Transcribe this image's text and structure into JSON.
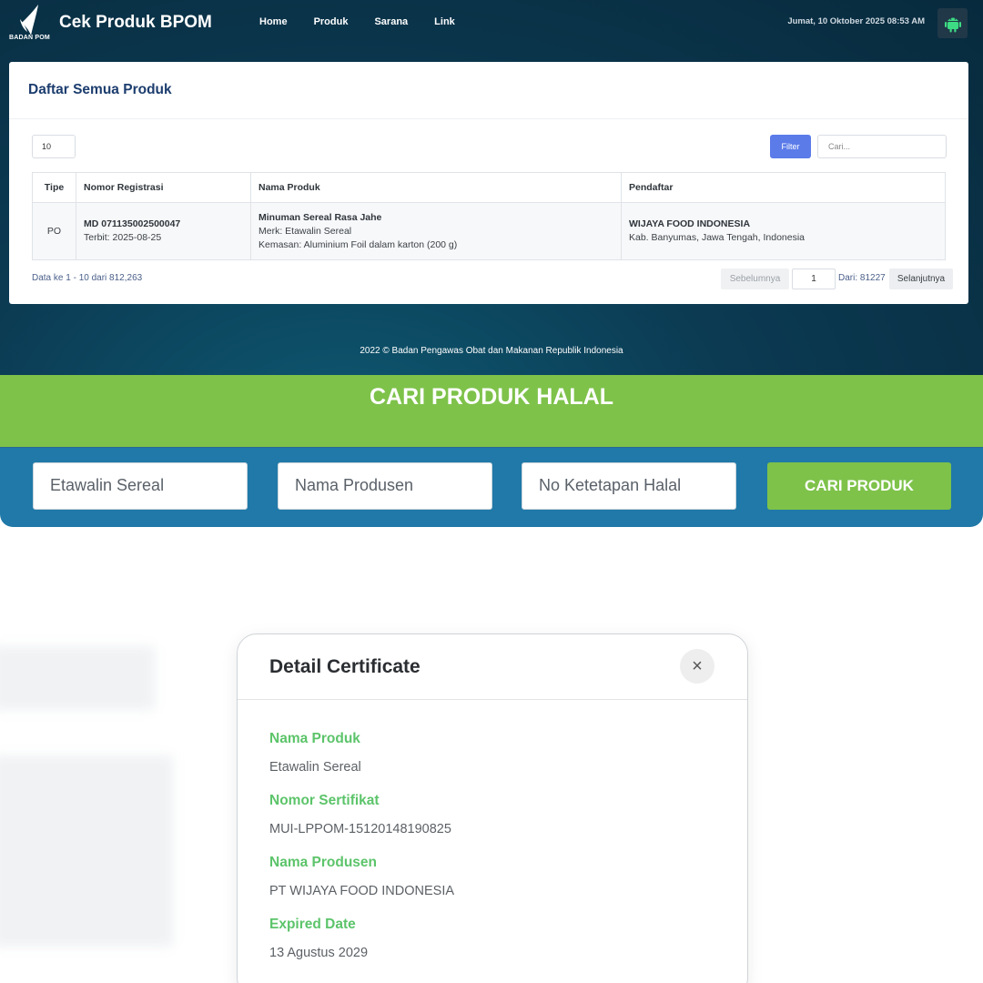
{
  "bpom": {
    "logo_text": "BADAN POM",
    "brand": "Cek Produk BPOM",
    "menu": [
      "Home",
      "Produk",
      "Sarana",
      "Link"
    ],
    "datetime": "Jumat, 10 Oktober 2025 08:53 AM",
    "card_title": "Daftar Semua Produk",
    "per_page": "10",
    "filter_label": "Filter",
    "search_placeholder": "Cari...",
    "table": {
      "headers": [
        "Tipe",
        "Nomor Registrasi",
        "Nama Produk",
        "Pendaftar"
      ],
      "row": {
        "tipe": "PO",
        "nomor": "MD 071135002500047",
        "terbit": "Terbit: 2025-08-25",
        "nama": "Minuman Sereal Rasa Jahe",
        "merk": "Merk: Etawalin Sereal",
        "kemasan": "Kemasan: Aluminium Foil dalam karton (200 g)",
        "pendaftar": "WIJAYA FOOD INDONESIA",
        "lokasi": "Kab. Banyumas, Jawa Tengah, Indonesia"
      }
    },
    "paging_info": "Data ke 1 - 10 dari 812,263",
    "prev_label": "Sebelumnya",
    "page_value": "1",
    "page_of": "Dari: 81227",
    "next_label": "Selanjutnya",
    "footer": "2022 ©  Badan Pengawas Obat dan Makanan Republik Indonesia"
  },
  "halal": {
    "title": "CARI PRODUK HALAL",
    "product_value": "Etawalin Sereal",
    "producer_placeholder": "Nama Produsen",
    "number_placeholder": "No Ketetapan Halal",
    "search_button": "CARI PRODUK"
  },
  "modal": {
    "title": "Detail Certificate",
    "close": "×",
    "fields": [
      {
        "label": "Nama Produk",
        "value": "Etawalin Sereal"
      },
      {
        "label": "Nomor Sertifikat",
        "value": "MUI-LPPOM-15120148190825"
      },
      {
        "label": "Nama Produsen",
        "value": "PT WIJAYA FOOD INDONESIA"
      },
      {
        "label": "Expired Date",
        "value": "13 Agustus 2029"
      }
    ]
  },
  "colors": {
    "bpom_bg": "#0b3a52",
    "filter_button": "#5b7be9",
    "halal_green": "#7ec24a",
    "halal_blue": "#2079a8",
    "modal_label_green": "#5cc46a",
    "android_green": "#3ddc84"
  },
  "icons": {
    "logo": "bpom-logo-icon",
    "android": "android-icon",
    "close": "close-icon"
  }
}
